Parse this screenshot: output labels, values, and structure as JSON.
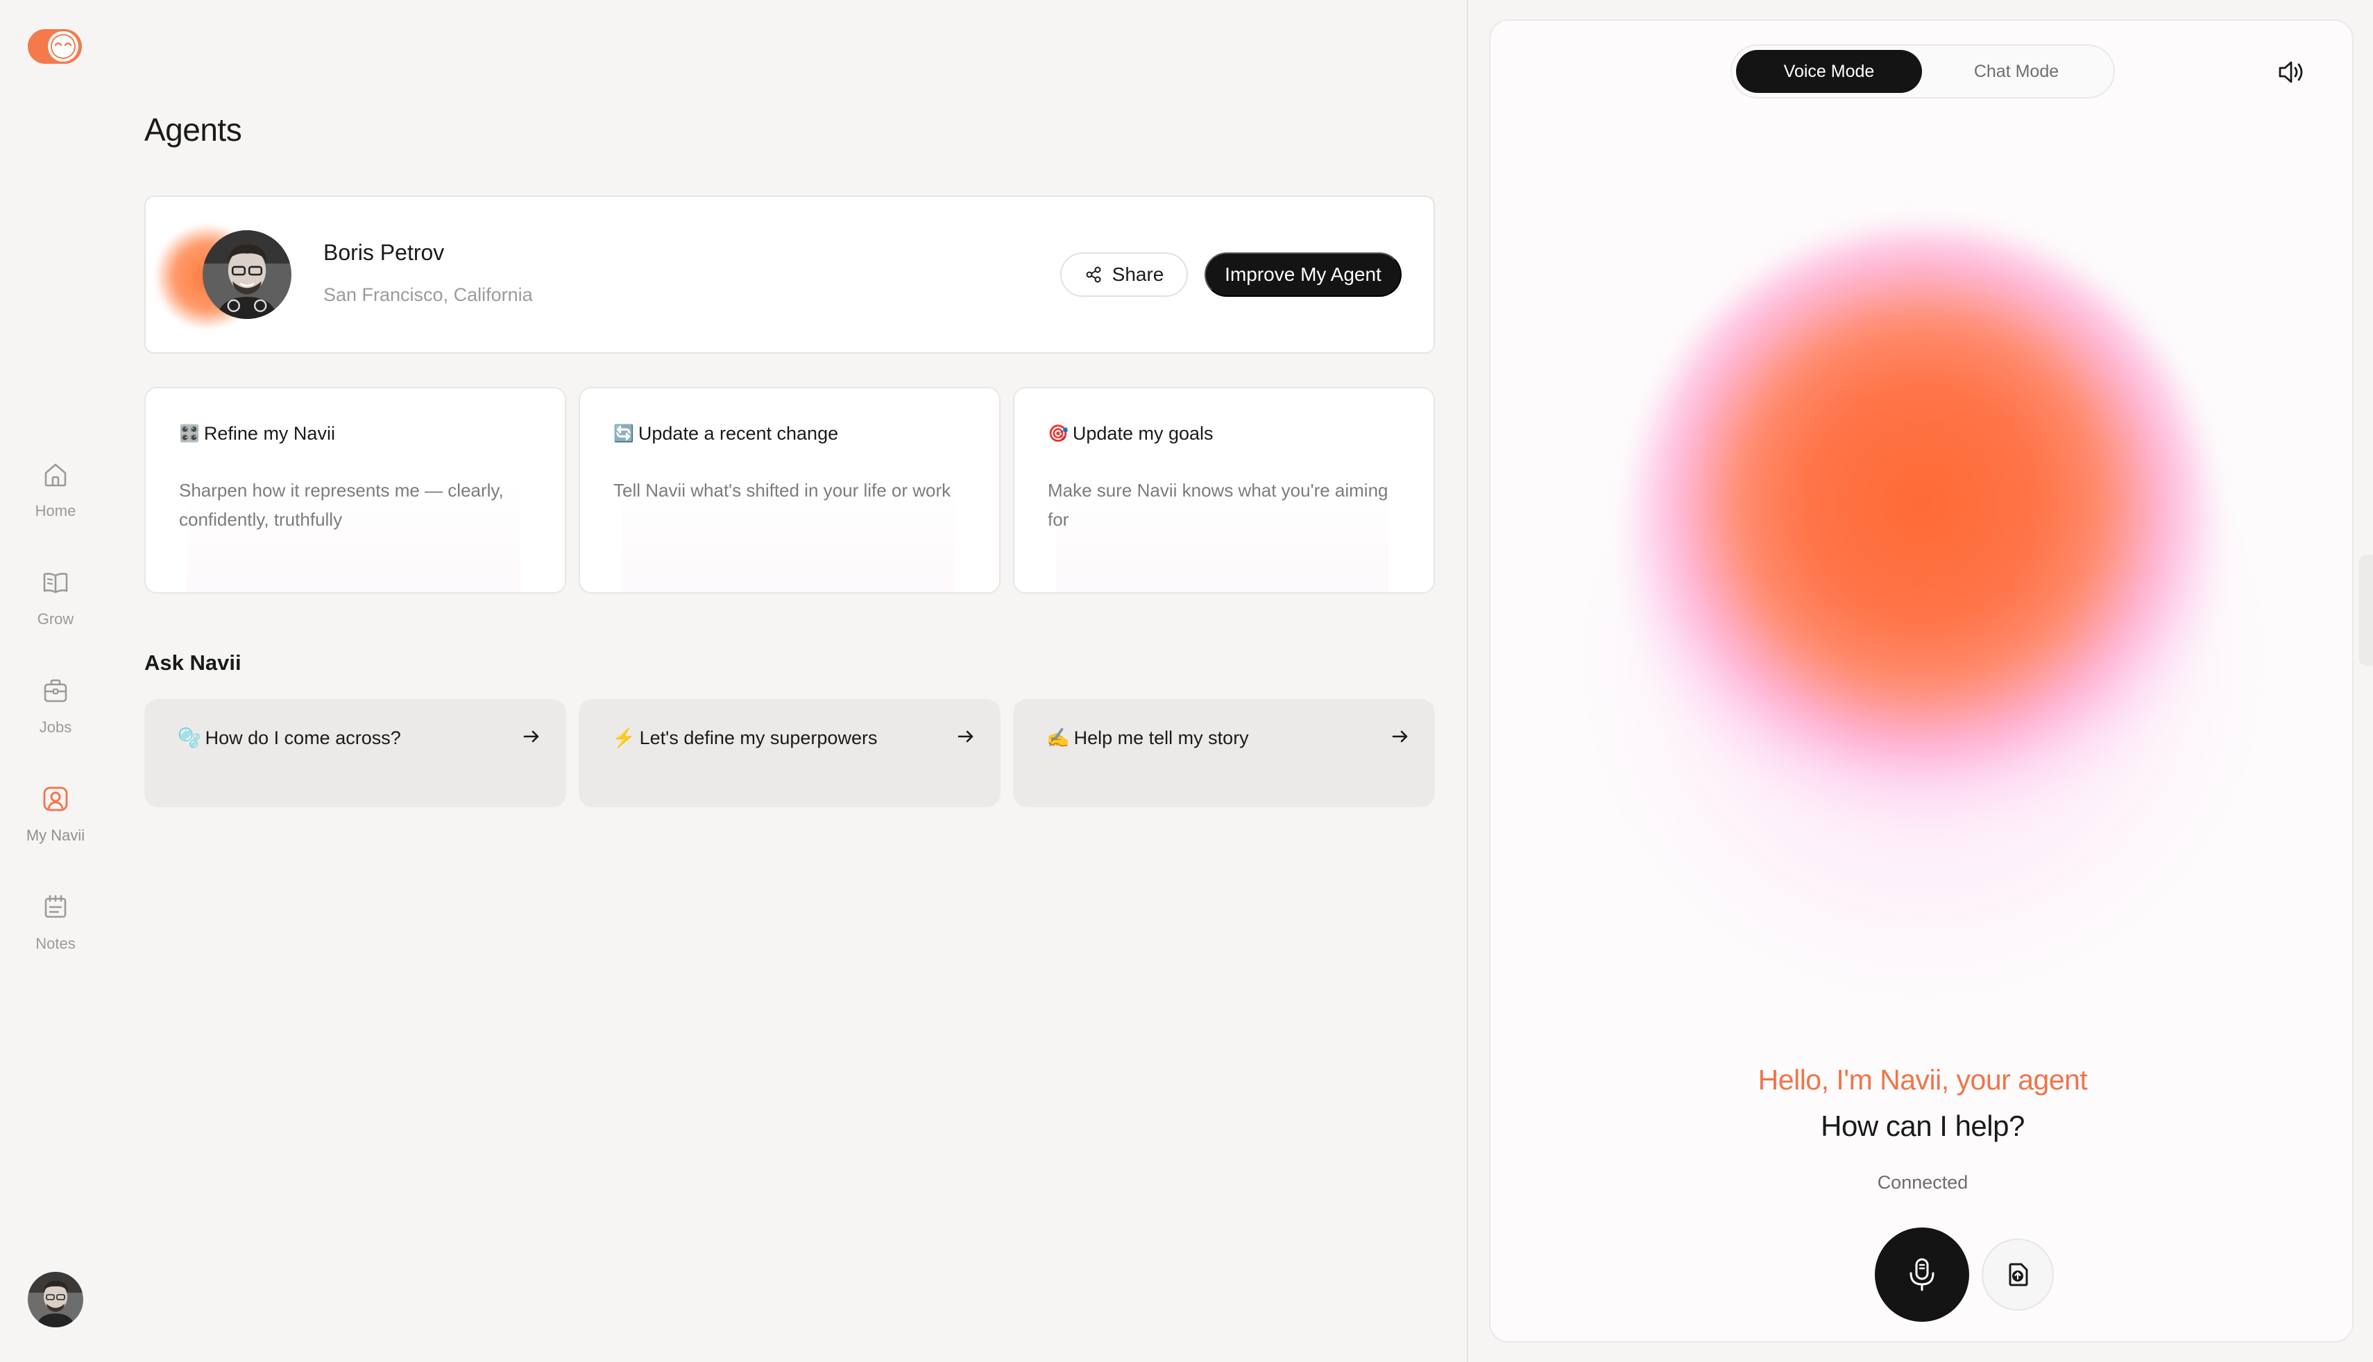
{
  "app": {
    "logo": "navii-logo",
    "accent_color": "#f0744a",
    "dark_color": "#141414"
  },
  "sidebar": {
    "items": [
      {
        "label": "Home",
        "icon": "home-icon",
        "active": false
      },
      {
        "label": "Grow",
        "icon": "book-icon",
        "active": false
      },
      {
        "label": "Jobs",
        "icon": "briefcase-icon",
        "active": false
      },
      {
        "label": "My Navii",
        "icon": "user-badge-icon",
        "active": true
      },
      {
        "label": "Notes",
        "icon": "notes-icon",
        "active": false
      }
    ],
    "avatar": "user-avatar"
  },
  "main": {
    "title": "Agents",
    "profile": {
      "name": "Boris Petrov",
      "location": "San Francisco, California",
      "share_label": "Share",
      "improve_label": "Improve My Agent"
    },
    "action_cards": [
      {
        "emoji": "🎛️",
        "title": "Refine my Navii",
        "description": "Sharpen how it represents me — clearly, confidently, truthfully"
      },
      {
        "emoji": "🔄",
        "title": "Update a recent change",
        "description": "Tell Navii what's shifted in your life or work"
      },
      {
        "emoji": "🎯",
        "title": "Update my goals",
        "description": "Make sure Navii knows what you're aiming for"
      }
    ],
    "ask_section_title": "Ask Navii",
    "prompts": [
      {
        "emoji": "🫧",
        "label": "How do I come across?"
      },
      {
        "emoji": "⚡",
        "label": "Let's define my superpowers"
      },
      {
        "emoji": "✍️",
        "label": "Help me tell my story"
      }
    ]
  },
  "voice_panel": {
    "modes": {
      "voice": "Voice Mode",
      "chat": "Chat Mode",
      "selected": "Voice Mode"
    },
    "greeting": "Hello, I'm Navii, your agent",
    "question": "How can I help?",
    "status": "Connected"
  }
}
